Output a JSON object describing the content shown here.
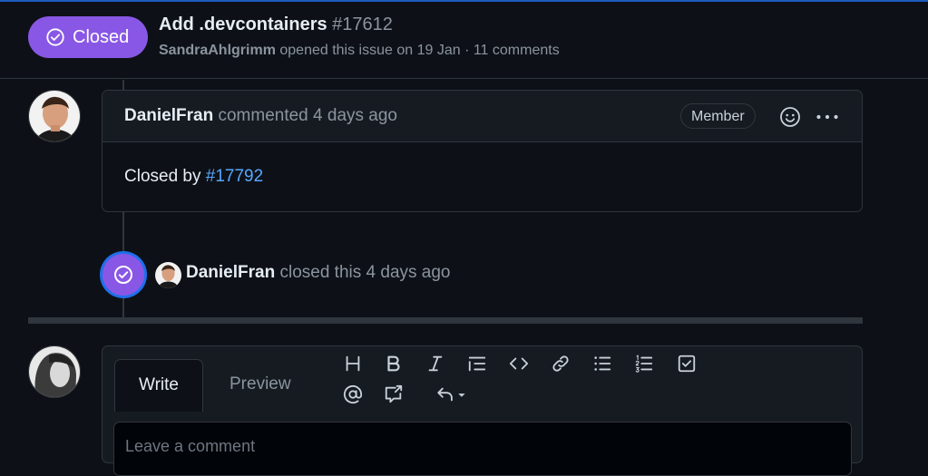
{
  "header": {
    "state_label": "Closed",
    "title": "Add .devcontainers",
    "number": "#17612",
    "author": "SandraAhlgrimm",
    "meta_text": " opened this issue on 19 Jan · 11 comments"
  },
  "comment": {
    "author": "DanielFran",
    "action": " commented 4 days ago",
    "role": "Member",
    "body_prefix": "Closed by ",
    "body_link": "#17792"
  },
  "event": {
    "actor": "DanielFran",
    "action": " closed this 4 days ago"
  },
  "composer": {
    "tab_write": "Write",
    "tab_preview": "Preview",
    "placeholder": "Leave a comment",
    "toolbar": [
      "heading-icon",
      "bold-icon",
      "italic-icon",
      "quote-icon",
      "code-icon",
      "link-icon",
      "bulleted-list-icon",
      "numbered-list-icon",
      "task-list-icon",
      "mention-icon",
      "cross-reference-icon",
      "saved-replies-icon"
    ]
  },
  "colors": {
    "closed_purple": "#8957e5",
    "link_blue": "#58a6ff",
    "background": "#0d1117"
  }
}
